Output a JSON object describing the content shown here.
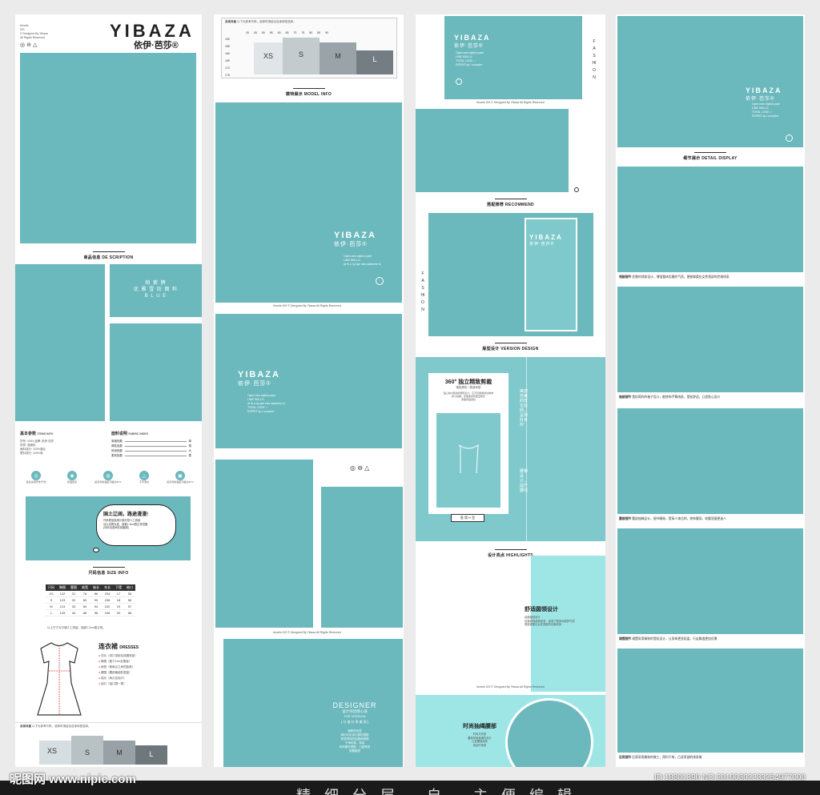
{
  "brand": {
    "name": "YIBAZA",
    "name_cn": "依伊·芭莎®",
    "designed_by": "© Designed By Yibaza",
    "rights": "All Rights Reserved",
    "novels": "Novels",
    "version": "S/S",
    "fashion": "FASHION",
    "slogan_lines": [
      "Open new stylish pace",
      "LINE SKILLS",
      "at th a ny spe ciss ssbsinhe to",
      "TOTAL LOOK ./",
      "ESPRIT sp./ compion"
    ],
    "footer": "Novels  S/S  © Designed By Yibaza   All Rights Reserved"
  },
  "col1": {
    "section_desc": "商品信息 DE SCRIPTION",
    "fabric_line1": "柏 紫 牌",
    "fabric_line2": "优 雅 雪 纺 面 料",
    "fabric_line3": "B L U E",
    "params_title": "基本参数",
    "params_title_en": "ITEMS INFO",
    "params": [
      "货号: X394  品牌: 依伊·芭莎",
      "材质: 涤面料",
      "面料成分: 100%涤纶",
      "里料成分: 100%涤"
    ],
    "fabric_title": "面料说明",
    "fabric_title_en": "FABRIC INDEX",
    "fabric_rows": [
      {
        "label": "厚度指数",
        "right": "厚"
      },
      {
        "label": "弹性指数",
        "right": "紧"
      },
      {
        "label": "修身指数",
        "right": "大"
      },
      {
        "label": "柔软指数",
        "right": "柔"
      }
    ],
    "care_icons": [
      {
        "icon": "hand-wash-icon",
        "glyph": "◎",
        "label": "建议采用手洗/干洗"
      },
      {
        "icon": "iron-icon",
        "glyph": "◉",
        "label": "低温熨烫"
      },
      {
        "icon": "temperature-icon",
        "glyph": "◍",
        "label": "最高洗涤温度不超过30°C"
      },
      {
        "icon": "no-bleach-icon",
        "glyph": "△",
        "label": "不可漂白"
      },
      {
        "icon": "tumble-icon",
        "glyph": "▣",
        "label": "最高洗涤温度不超过30°C"
      }
    ],
    "bubble_title": "国土辽阔，路途漫漫!",
    "bubble_lines": [
      "尺码表信息统计部分是人工测量",
      "请以实物为准，误差1-3cm属正常范围",
      "(详情请咨询在线客服)"
    ],
    "section_size": "尺码信息 SIZE INFO",
    "size_headers": [
      "尺码",
      "胸围",
      "腰围",
      "肩宽",
      "袖长",
      "衣长",
      "下摆",
      "袖口"
    ],
    "size_rows": [
      [
        "XS",
        "122",
        "31",
        "76",
        "86",
        "234",
        "17",
        "55"
      ],
      [
        "S",
        "123",
        "32",
        "80",
        "90",
        "238",
        "18",
        "56"
      ],
      [
        "M",
        "124",
        "33",
        "84",
        "94",
        "242",
        "19",
        "57"
      ],
      [
        "L",
        "125",
        "34",
        "88",
        "98",
        "246",
        "20",
        "58"
      ]
    ],
    "size_note": "以上尺寸为平铺人工测量，误差1-3cm属正常。",
    "dress_title": "连衣裙",
    "dress_title_en": "DRESSES",
    "dress_items": [
      "衣长（领口顶部至裙摆底部）",
      "胸围（腋下1cm处围量）",
      "肩宽（两肩点之间的距离）",
      "腰围（腰部最细处围量）",
      "袖长（肩点至袖口）",
      "袖口（袖口围一周）"
    ],
    "chart_title": "身高体重",
    "chart_note": "以下为参考尺码，选择时请结合自身体型选择。",
    "chart_heights": [
      "150",
      "155",
      "160",
      "165",
      "170",
      "175"
    ],
    "chart_weights": [
      "40",
      "45",
      "50",
      "55",
      "60",
      "65",
      "70",
      "75",
      "80",
      "85",
      "90"
    ],
    "chart_sizes": [
      "XS",
      "S",
      "M",
      "L"
    ]
  },
  "col2": {
    "section_model": "模特展示 MODEL INFO",
    "designer": "DESIGNER",
    "designer_sub": "设计师灵感心语",
    "designer_en": "THE VERSION",
    "designer_tag": "[ 与 谁 分 享 美 丽 ]",
    "designer_lines": [
      "清新的出发",
      "简约衬衫设计感的搭配",
      "彰显率真的态度和美丽",
      "干净利落、简洁",
      "时尚更好搭配，凸显率真",
      "穿着随意"
    ]
  },
  "col3": {
    "section_recommend": "搭配推荐 RECOMMEND",
    "section_version": "版型设计 VERSION DESIGN",
    "version_big": "360°",
    "version_title": "独立精致剪裁",
    "version_sub": "宽松廓形 / 修身有型",
    "version_lines": [
      "贴心的H型宽松廓形设计，它不仅能够遮住肉肉",
      "的小肚腩，还能使身形更显修长",
      "穿着舒适感好"
    ],
    "version_tag": "直 筒 H 型",
    "version_vertical_1": "美感完美的优化比例，呈现好身材",
    "version_vertical_2": "腰带设计，提升腰线",
    "section_highlights": "设计亮点 HIGHLIGHTS",
    "hl1_title": "舒适圆领设计",
    "hl1_lines": [
      "经典圆领设计",
      "优雅修饰颈部线条，增强了整体优雅的气质",
      "更能够柔化女性颈部的优美线条"
    ],
    "hl2_title": "时尚抽绳腰部",
    "hl2_lines": [
      "时尚又有型",
      "腰部采用抽绳的设计",
      "凸显腰部曲线",
      "增加时尚感"
    ]
  },
  "col4": {
    "section_detail": "细节展示 DETAIL DISPLAY",
    "captions": [
      {
        "title": "领部细节",
        "text": "优雅的领部设计，增强整体优雅的气质，更能够柔化女性颈部的完美线条"
      },
      {
        "title": "袖部细节",
        "text": "宽松简约的袖子设计，能修饰手臂线条，宽松舒适，凸显贴心设计"
      },
      {
        "title": "腰部细节",
        "text": "腰部抽绳设计，细节精致，提高人体比例，修饰腰身，收腰显瘦更迷人"
      },
      {
        "title": "裙摆细节",
        "text": "裙摆采用精致的宽松设计，让身体更显轻盈，行走飘逸更加优雅"
      },
      {
        "title": "后背细节",
        "text": "后背采用精致的做工，简约干练，凸显背部的线条美"
      }
    ]
  },
  "watermark": {
    "left": "昵图网 www.nipic.com",
    "right": "ID:18301390 NO:20190302233254977000",
    "bottom": "精 细 分 层 · 自 · 主 便 编 辑"
  },
  "colors": {
    "teal": "#6bb8bd",
    "light_teal": "#7fc9cc",
    "cyan": "#9ee6e6",
    "background": "#ebebeb"
  }
}
